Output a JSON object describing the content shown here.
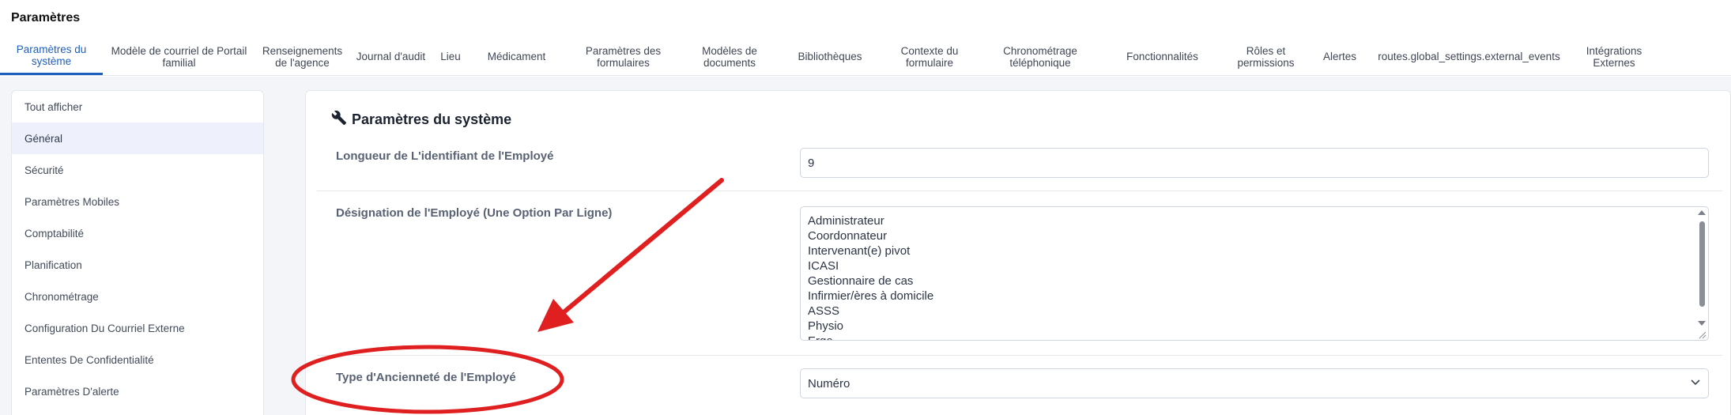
{
  "page": {
    "title": "Paramètres"
  },
  "tabs": [
    {
      "label": "Paramètres du système",
      "active": true
    },
    {
      "label": "Modèle de courriel de Portail familial"
    },
    {
      "label": "Renseignements de l'agence"
    },
    {
      "label": "Journal d'audit"
    },
    {
      "label": "Lieu"
    },
    {
      "label": "Médicament"
    },
    {
      "label": "Paramètres des formulaires"
    },
    {
      "label": "Modèles de documents"
    },
    {
      "label": "Bibliothèques"
    },
    {
      "label": "Contexte du formulaire"
    },
    {
      "label": "Chronométrage téléphonique"
    },
    {
      "label": "Fonctionnalités"
    },
    {
      "label": "Rôles et permissions"
    },
    {
      "label": "Alertes"
    },
    {
      "label": "routes.global_settings.external_events"
    },
    {
      "label": "Intégrations Externes"
    }
  ],
  "sidebar": {
    "items": [
      {
        "label": "Tout afficher"
      },
      {
        "label": "Général",
        "active": true
      },
      {
        "label": "Sécurité"
      },
      {
        "label": "Paramètres Mobiles"
      },
      {
        "label": "Comptabilité"
      },
      {
        "label": "Planification"
      },
      {
        "label": "Chronométrage"
      },
      {
        "label": "Configuration Du Courriel Externe"
      },
      {
        "label": "Ententes De Confidentialité"
      },
      {
        "label": "Paramètres D'alerte"
      }
    ]
  },
  "panel": {
    "title": "Paramètres du système",
    "title_icon": "wrench-icon",
    "fields": {
      "employee_id_length": {
        "label": "Longueur de L'identifiant de l'Employé",
        "value": "9"
      },
      "employee_designation": {
        "label": "Désignation de l'Employé (Une Option Par Ligne)",
        "lines": [
          "Administrateur",
          "Coordonnateur",
          "Intervenant(e) pivot",
          "ICASI",
          "Gestionnaire de cas",
          "Infirmier/ères à domicile",
          "ASSS",
          "Physio",
          "Ergo"
        ]
      },
      "seniority_type": {
        "label": "Type d'Ancienneté de l'Employé",
        "value": "Numéro"
      }
    }
  },
  "annotations": {
    "color": "#e02020"
  }
}
